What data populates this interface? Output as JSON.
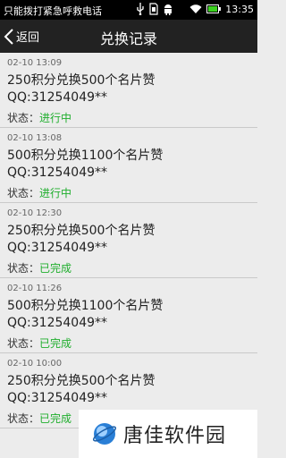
{
  "status_bar": {
    "carrier": "只能拨打紧急呼救电话",
    "time": "13:35"
  },
  "header": {
    "back_label": "返回",
    "title": "兑换记录"
  },
  "records": [
    {
      "time": "02-10 13:09",
      "name": "250积分兑换500个名片赞",
      "qq": "QQ:31254049**",
      "status_label": "状态：",
      "status_value": "进行中"
    },
    {
      "time": "02-10 13:08",
      "name": "500积分兑换1100个名片赞",
      "qq": "QQ:31254049**",
      "status_label": "状态：",
      "status_value": "进行中"
    },
    {
      "time": "02-10 12:30",
      "name": "250积分兑换500个名片赞",
      "qq": "QQ:31254049**",
      "status_label": "状态：",
      "status_value": "已完成"
    },
    {
      "time": "02-10 11:26",
      "name": "500积分兑换1100个名片赞",
      "qq": "QQ:31254049**",
      "status_label": "状态：",
      "status_value": "已完成"
    },
    {
      "time": "02-10 10:00",
      "name": "250积分兑换500个名片赞",
      "qq": "QQ:31254049**",
      "status_label": "状态：",
      "status_value": "已完成"
    }
  ],
  "watermark": {
    "text": "唐佳软件园"
  },
  "colors": {
    "status_green": "#1fae2d",
    "titlebar": "#222222",
    "background": "#ececec"
  }
}
